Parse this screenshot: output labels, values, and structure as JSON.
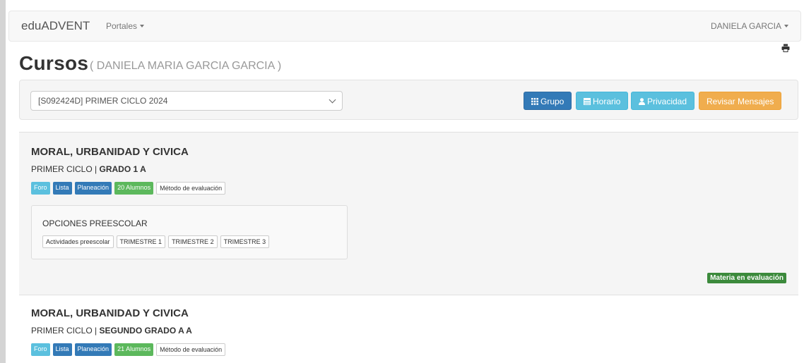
{
  "navbar": {
    "brand": "eduADVENT",
    "portales": "Portales",
    "user": "DANIELA GARCIA"
  },
  "page": {
    "title": "Cursos",
    "subtitle": "( DANIELA MARIA GARCIA GARCIA )"
  },
  "selector": {
    "value": "[S092424D] PRIMER CICLO 2024"
  },
  "buttons": {
    "grupo": "Grupo",
    "horario": "Horario",
    "privacidad": "Privacidad",
    "mensajes": "Revisar Mensajes"
  },
  "courses": [
    {
      "title": "MORAL, URBANIDAD Y CIVICA",
      "ciclo": "PRIMER CICLO",
      "grado": "GRADO 1 A",
      "tags": {
        "foro": "Foro",
        "lista": "Lista",
        "planeacion": "Planeación",
        "alumnos": "20 Alumnos",
        "metodo": "Método de evaluación"
      },
      "options_title": "OPCIONES PREESCOLAR",
      "options": [
        "Actividades preescolar",
        "TRIMESTRE 1",
        "TRIMESTRE 2",
        "TRIMESTRE 3"
      ],
      "status": "Materia en evaluación"
    },
    {
      "title": "MORAL, URBANIDAD Y CIVICA",
      "ciclo": "PRIMER CICLO",
      "grado": "SEGUNDO GRADO A A",
      "tags": {
        "foro": "Foro",
        "lista": "Lista",
        "planeacion": "Planeación",
        "alumnos": "21 Alumnos",
        "metodo": "Método de evaluación"
      }
    }
  ],
  "separator": "|",
  "icons": {
    "print": "print-icon",
    "grupo": "grid-icon",
    "horario": "calendar-icon",
    "privacidad": "user-icon"
  },
  "colors": {
    "primary": "#337ab7",
    "info": "#5bc0de",
    "success": "#5cb85c",
    "warning": "#f0ad4e"
  }
}
